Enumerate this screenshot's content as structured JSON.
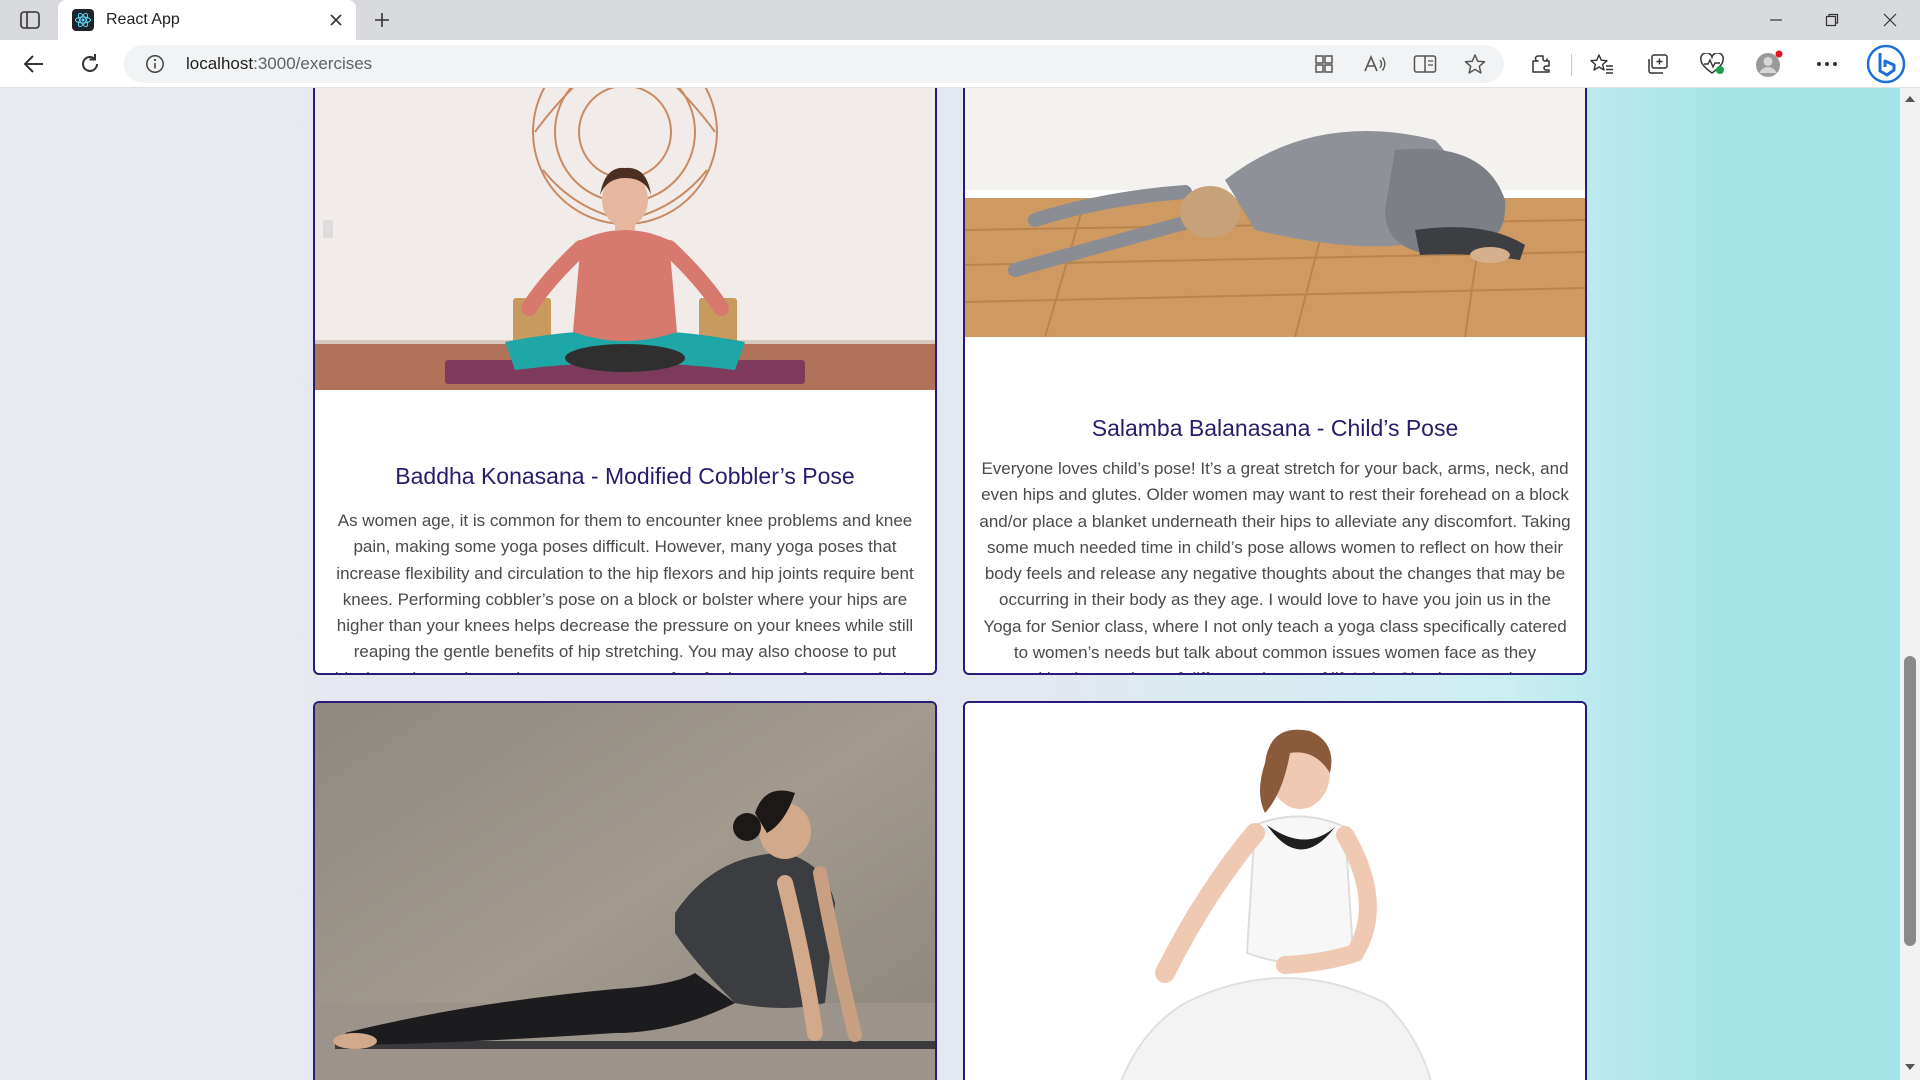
{
  "browser": {
    "tab_title": "React App",
    "url_host": "localhost",
    "url_path": ":3000/exercises"
  },
  "exercises": [
    {
      "title": "Baddha Konasana - Modified Cobbler’s Pose",
      "description": "As women age, it is common for them to encounter knee problems and knee pain, making some yoga poses difficult. However, many yoga poses that increase flexibility and circulation to the hip flexors and hip joints require bent knees. Performing cobbler’s pose on a block or bolster where your hips are higher than your knees helps decrease the pressure on your knees while still reaping the gentle benefits of hip stretching. You may also choose to put blocks underneath your knees or move your feet further away from your body so that the angle of bend in your knees isn’t as sharp."
    },
    {
      "title": "Salamba Balanasana - Child’s Pose",
      "description": "Everyone loves child’s pose! It’s a great stretch for your back, arms, neck, and even hips and glutes. Older women may want to rest their forehead on a block and/or place a blanket underneath their hips to alleviate any discomfort. Taking some much needed time in child’s pose allows women to reflect on how their body feels and release any negative thoughts about the changes that may be occurring in their body as they age. I would love to have you join us in the Yoga for Senior class, where I not only teach a yoga class specifically catered to women’s needs but talk about common issues women face as they transition into and out of different phases of life! also Check out our latest Wellness class for seniors!"
    }
  ]
}
